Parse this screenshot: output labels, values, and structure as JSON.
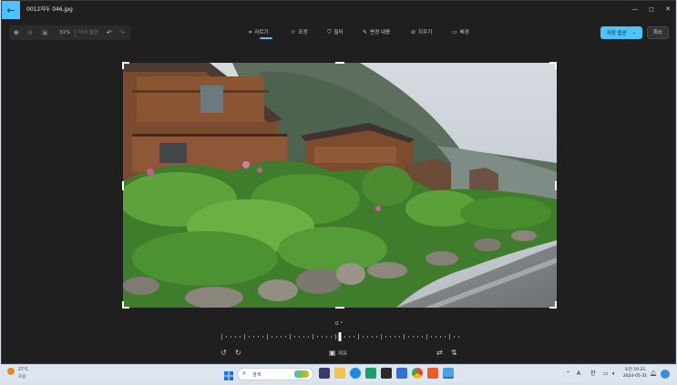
{
  "window": {
    "title": "0012자두 046.jpg",
    "minimize_glyph": "—",
    "maximize_glyph": "◻",
    "close_glyph": "✕"
  },
  "zoom_panel": {
    "zoom_level": "31%",
    "reset_label": "다시 설정"
  },
  "edit_tabs": [
    {
      "label": "자르기",
      "icon": "crop-icon",
      "glyph": "⌗",
      "active": true
    },
    {
      "label": "조정",
      "icon": "adjust-icon",
      "glyph": "☼",
      "active": false
    },
    {
      "label": "필터",
      "icon": "filter-icon",
      "glyph": "⛉",
      "active": false
    },
    {
      "label": "변경 내용",
      "icon": "markup-icon",
      "glyph": "✎",
      "active": false
    },
    {
      "label": "지우기",
      "icon": "erase-icon",
      "glyph": "⊘",
      "active": false
    },
    {
      "label": "배경",
      "icon": "background-icon",
      "glyph": "▭",
      "active": false
    }
  ],
  "actions": {
    "save_label": "저장 옵션",
    "save_dropdown_glyph": "⌄",
    "cancel_label": "취소"
  },
  "crop": {
    "angle": "0 °",
    "reset_label": "자유"
  },
  "taskbar": {
    "weather_temp": "27°C",
    "weather_desc": "흐림",
    "search_placeholder": "검색",
    "tray_ime": "A",
    "tray_lang": "한",
    "time": "오전 10:21",
    "date": "2024-05-31"
  },
  "colors": {
    "accent": "#4cc2ff",
    "app_bg": "#1f1f1f",
    "taskbar_bg": "#dde6f0"
  }
}
